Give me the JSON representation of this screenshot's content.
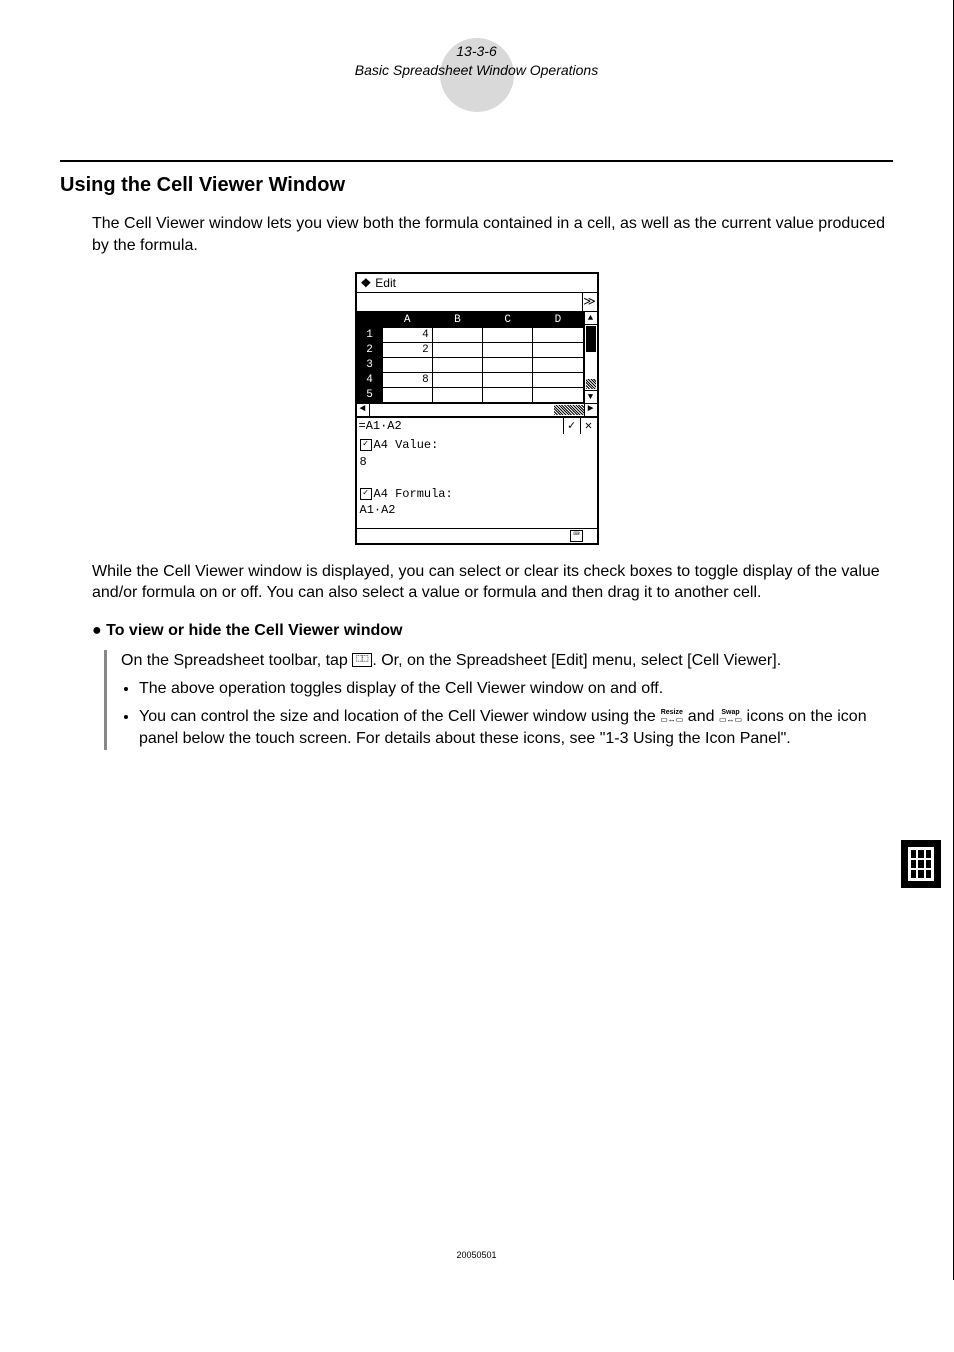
{
  "header": {
    "page_ref": "13-3-6",
    "chapter": "Basic Spreadsheet Window Operations"
  },
  "section_title": "Using the Cell Viewer Window",
  "intro": "The Cell Viewer window lets you view both the formula contained in a cell, as well as the current value produced by the formula.",
  "screenshot": {
    "menu_items": [
      "Edit"
    ],
    "columns": [
      "A",
      "B",
      "C",
      "D"
    ],
    "rows": [
      "1",
      "2",
      "3",
      "4",
      "5"
    ],
    "cells": {
      "A1": "4",
      "A2": "2",
      "A3": "",
      "A4": "8",
      "A5": ""
    },
    "formula_bar": "=A1·A2",
    "ok_btn": "✓",
    "cancel_btn": "✕",
    "viewer": {
      "value_label": "A4 Value:",
      "value": "8",
      "formula_label": "A4 Formula:",
      "formula": "A1·A2"
    }
  },
  "para2": "While the Cell Viewer window is displayed, you can select or clear its check boxes to toggle display of the value and/or formula on or off. You can also select a value or formula and then drag it to another cell.",
  "proc": {
    "heading_bullet": "●",
    "heading": "To view or hide the Cell Viewer window",
    "line1a": "On the Spreadsheet toolbar, tap ",
    "line1b": ". Or, on the Spreadsheet [Edit] menu, select [Cell Viewer].",
    "bullet1": "The above operation toggles display of the Cell Viewer window on and off.",
    "bullet2a": "You can control the size and location of the Cell Viewer window using the ",
    "bullet2b": " and ",
    "bullet2c": " icons on the icon panel below the touch screen. For details about these icons, see \"1-3 Using the Icon Panel\".",
    "icon_resize": "Resize",
    "icon_swap": "Swap"
  },
  "footer": "20050501",
  "chart_data": {
    "type": "table",
    "title": "Spreadsheet cells shown in Cell Viewer example",
    "columns": [
      "A"
    ],
    "rows": [
      "1",
      "2",
      "3",
      "4",
      "5"
    ],
    "values": [
      [
        4
      ],
      [
        2
      ],
      [
        null
      ],
      [
        8
      ],
      [
        null
      ]
    ],
    "active_cell": "A4",
    "active_formula": "A1·A2",
    "active_value": 8
  }
}
